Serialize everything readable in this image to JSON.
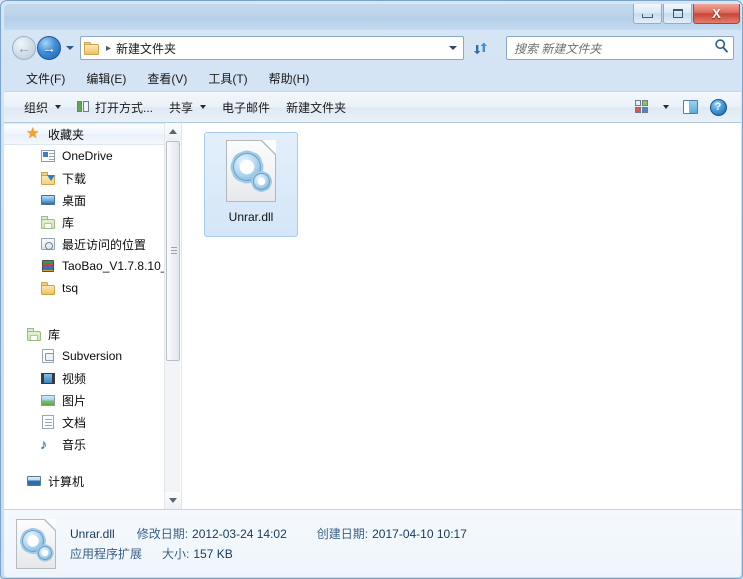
{
  "window": {
    "minimize_label": "–",
    "maximize_label": "",
    "close_label": "X"
  },
  "navigation": {
    "back_glyph": "←",
    "forward_glyph": "→",
    "breadcrumb_separator": "▸",
    "breadcrumb": "新建文件夹"
  },
  "search": {
    "placeholder": "搜索 新建文件夹",
    "icon": "search-icon"
  },
  "menubar": {
    "items": [
      {
        "label": "文件(F)"
      },
      {
        "label": "编辑(E)"
      },
      {
        "label": "查看(V)"
      },
      {
        "label": "工具(T)"
      },
      {
        "label": "帮助(H)"
      }
    ]
  },
  "commandbar": {
    "organize": "组织",
    "open_with": "打开方式...",
    "share": "共享",
    "email": "电子邮件",
    "new_folder": "新建文件夹",
    "help_label": "?"
  },
  "sidebar": {
    "sections": [
      {
        "header": "收藏夹",
        "header_icon": "star-icon",
        "highlighted": true,
        "items": [
          {
            "label": "OneDrive",
            "icon": "onedrive-icon"
          },
          {
            "label": "下载",
            "icon": "downloads-folder-icon"
          },
          {
            "label": "桌面",
            "icon": "desktop-icon"
          },
          {
            "label": "库",
            "icon": "library-folder-icon"
          },
          {
            "label": "最近访问的位置",
            "icon": "recent-places-icon"
          },
          {
            "label": "TaoBao_V1.7.8.10_",
            "icon": "rar-archive-icon"
          },
          {
            "label": "tsq",
            "icon": "folder-icon"
          }
        ]
      },
      {
        "header": "库",
        "header_icon": "library-folder-icon",
        "highlighted": false,
        "items": [
          {
            "label": "Subversion",
            "icon": "subversion-icon"
          },
          {
            "label": "视频",
            "icon": "videos-icon"
          },
          {
            "label": "图片",
            "icon": "pictures-icon"
          },
          {
            "label": "文档",
            "icon": "documents-icon"
          },
          {
            "label": "音乐",
            "icon": "music-icon"
          }
        ]
      },
      {
        "header": "计算机",
        "header_icon": "computer-icon",
        "highlighted": false,
        "clipped": true,
        "items": []
      }
    ]
  },
  "files": [
    {
      "name": "Unrar.dll",
      "icon": "dll-gears-icon",
      "selected": true
    }
  ],
  "statusbar": {
    "name": "Unrar.dll",
    "type": "应用程序扩展",
    "modified_label": "修改日期:",
    "modified_value": "2012-03-24 14:02",
    "created_label": "创建日期:",
    "created_value": "2017-04-10 10:17",
    "size_label": "大小:",
    "size_value": "157 KB"
  },
  "colors": {
    "accent": "#2f6fa8",
    "close_button": "#c8453a",
    "selection": "#d4e6f8",
    "titlebar": "#bcd4ea"
  }
}
